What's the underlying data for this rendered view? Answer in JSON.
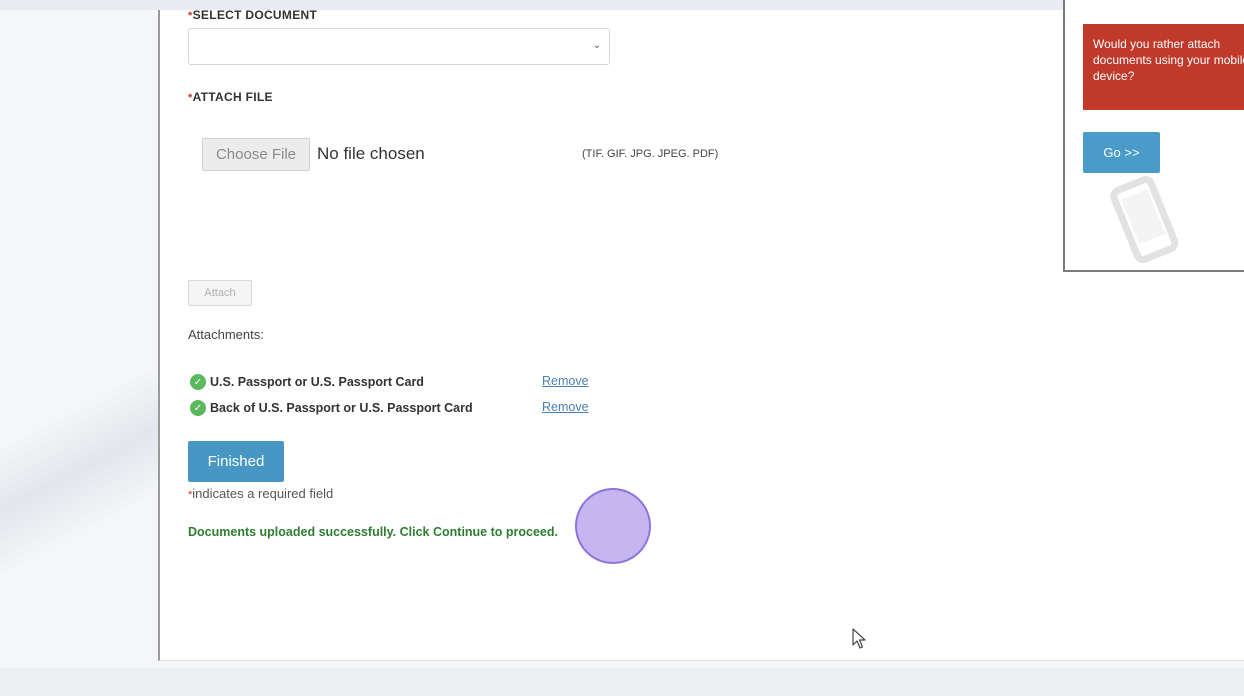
{
  "form": {
    "required_mark": "*",
    "select_document_label": "SELECT DOCUMENT",
    "select_document_value": "",
    "attach_file_label": "ATTACH FILE",
    "choose_file_button": "Choose File",
    "no_file_text": "No file chosen",
    "allowed_types": "(TIF. GIF. JPG. JPEG. PDF)",
    "attach_button": "Attach",
    "attachments_heading": "Attachments:",
    "attachments": [
      {
        "name": "U.S. Passport or U.S. Passport Card",
        "action": "Remove"
      },
      {
        "name": "Back of U.S. Passport or U.S. Passport Card",
        "action": "Remove"
      }
    ],
    "finished_button": "Finished",
    "required_note": "indicates a required field",
    "success_message": "Documents uploaded successfully. Click Continue to proceed."
  },
  "mobile_prompt": {
    "text": "Would you rather attach documents using your mobile device?",
    "go_button": "Go >>"
  },
  "icons": {
    "attachment_status": "check-circle-icon",
    "select_arrow": "chevron-down-icon",
    "mobile": "mobile-phone-icon",
    "cursor": "mouse-pointer-icon"
  },
  "colors": {
    "required": "#c0392b",
    "primary_button": "#4796c4",
    "success_text": "#2e7d32",
    "check_icon": "#5cb85c",
    "mobile_banner": "#c0392b",
    "link": "#4a7fb5",
    "click_highlight": "#9678e6"
  }
}
